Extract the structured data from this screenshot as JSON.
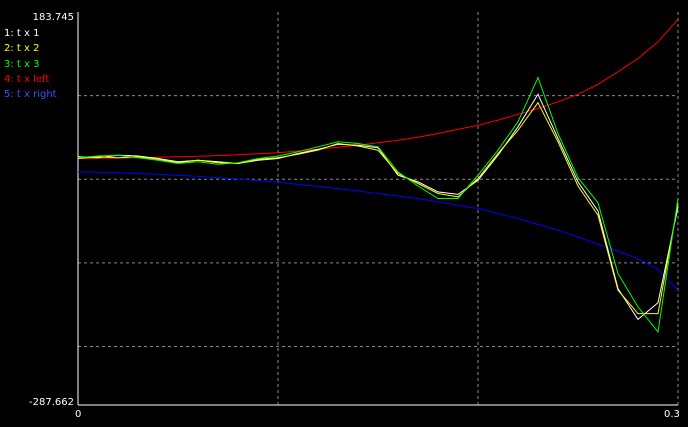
{
  "chart_data": {
    "type": "line",
    "title": "",
    "xlabel": "",
    "ylabel": "",
    "xlim": [
      0,
      0.3
    ],
    "ylim": [
      -287.662,
      183.745
    ],
    "x_tick_labels": [
      "0",
      "0.3"
    ],
    "y_tick_labels": [
      "183.745",
      "-287.662"
    ],
    "grid": true,
    "legend_position": "top-left",
    "background": "#000000",
    "x_samples": [
      0.0,
      0.01,
      0.02,
      0.03,
      0.04,
      0.05,
      0.06,
      0.07,
      0.08,
      0.09,
      0.1,
      0.11,
      0.12,
      0.13,
      0.14,
      0.15,
      0.16,
      0.17,
      0.18,
      0.19,
      0.2,
      0.21,
      0.22,
      0.23,
      0.24,
      0.25,
      0.26,
      0.27,
      0.28,
      0.29,
      0.3
    ],
    "series": [
      {
        "name": "1: t x 1",
        "color": "#ffffff",
        "values": [
          10,
          9,
          12,
          11,
          8,
          4,
          6,
          4,
          2,
          6,
          8,
          14,
          19,
          25,
          24,
          21,
          -12,
          -20,
          -32,
          -35,
          -18,
          12,
          46,
          85,
          32,
          -20,
          -55,
          -148,
          -185,
          -165,
          -50
        ]
      },
      {
        "name": "2: t x 2",
        "color": "#ffff00",
        "values": [
          8,
          10,
          9,
          10,
          7,
          3,
          6,
          3,
          2,
          7,
          9,
          13,
          18,
          26,
          23,
          18,
          -10,
          -22,
          -34,
          -38,
          -16,
          14,
          42,
          75,
          28,
          -25,
          -60,
          -150,
          -178,
          -178,
          -45
        ]
      },
      {
        "name": "3: t x 3",
        "color": "#00ff00",
        "values": [
          9,
          11,
          12,
          9,
          6,
          2,
          4,
          1,
          3,
          8,
          11,
          16,
          22,
          28,
          26,
          22,
          -8,
          -25,
          -40,
          -40,
          -12,
          18,
          52,
          105,
          38,
          -15,
          -45,
          -130,
          -170,
          -200,
          -40
        ]
      },
      {
        "name": "4: t x left",
        "color": "#ff0000",
        "values": [
          8,
          8.2,
          8.5,
          9,
          9.5,
          10,
          10.8,
          11.5,
          12.5,
          13.8,
          15,
          17,
          19,
          21.5,
          24,
          27,
          30,
          33.5,
          38,
          43,
          48,
          54,
          61,
          68,
          76,
          85,
          97,
          112,
          128,
          148,
          175
        ]
      },
      {
        "name": "5: t x right",
        "color": "#0000ff",
        "values": [
          -8,
          -8.5,
          -9,
          -10,
          -11,
          -12,
          -13.5,
          -15,
          -16.5,
          -18.5,
          -20.5,
          -23,
          -25.5,
          -28,
          -31,
          -34,
          -37,
          -40,
          -44,
          -48,
          -52,
          -58,
          -64,
          -71,
          -78,
          -86,
          -95,
          -103,
          -112,
          -125,
          -150
        ]
      }
    ]
  }
}
